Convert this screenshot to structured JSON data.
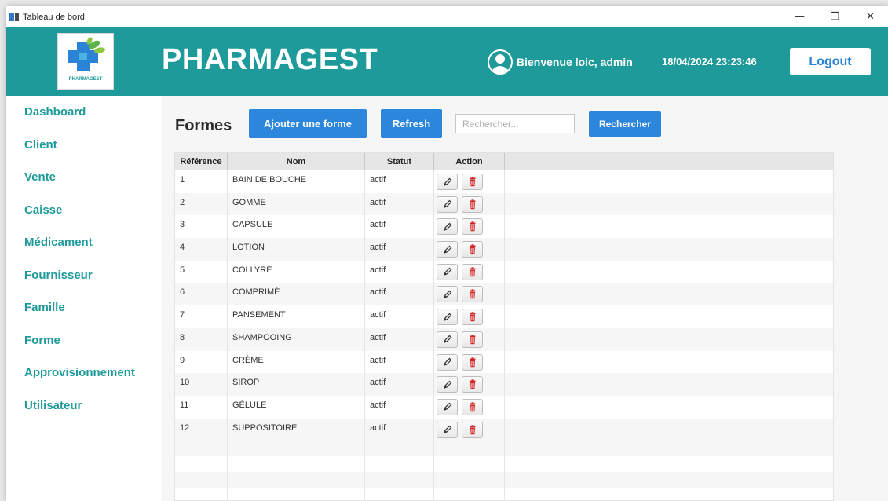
{
  "window": {
    "title": "Tableau de bord",
    "minimize": "—",
    "maximize": "❐",
    "close": "✕"
  },
  "header": {
    "logo_text": "PHARMAGEST",
    "brand": "PHARMAGEST",
    "welcome": "Bienvenue loic, admin",
    "datetime": "18/04/2024 23:23:46",
    "logout_label": "Logout",
    "color": "#1e9a9a"
  },
  "sidebar": {
    "items": [
      {
        "label": "Dashboard"
      },
      {
        "label": "Client"
      },
      {
        "label": "Vente"
      },
      {
        "label": "Caisse"
      },
      {
        "label": "Médicament"
      },
      {
        "label": "Fournisseur"
      },
      {
        "label": "Famille"
      },
      {
        "label": "Forme"
      },
      {
        "label": "Approvisionnement"
      },
      {
        "label": "Utilisateur"
      }
    ]
  },
  "main": {
    "title": "Formes",
    "add_label": "Ajouter une forme",
    "refresh_label": "Refresh",
    "search_placeholder": "Rechercher...",
    "search_label": "Rechercher",
    "table": {
      "columns": [
        "Référence",
        "Nom",
        "Statut",
        "Action"
      ],
      "rows": [
        {
          "ref": "1",
          "nom": "BAIN DE BOUCHE",
          "statut": "actif"
        },
        {
          "ref": "2",
          "nom": "GOMME",
          "statut": "actif"
        },
        {
          "ref": "3",
          "nom": "CAPSULE",
          "statut": "actif"
        },
        {
          "ref": "4",
          "nom": "LOTION",
          "statut": "actif"
        },
        {
          "ref": "5",
          "nom": "COLLYRE",
          "statut": "actif"
        },
        {
          "ref": "6",
          "nom": "COMPRIMÉ",
          "statut": "actif"
        },
        {
          "ref": "7",
          "nom": "PANSEMENT",
          "statut": "actif"
        },
        {
          "ref": "8",
          "nom": "SHAMPOOING",
          "statut": "actif"
        },
        {
          "ref": "9",
          "nom": "CRÈME",
          "statut": "actif"
        },
        {
          "ref": "10",
          "nom": "SIROP",
          "statut": "actif"
        },
        {
          "ref": "11",
          "nom": "GÉLULE",
          "statut": "actif"
        },
        {
          "ref": "12",
          "nom": "SUPPOSITOIRE",
          "statut": "actif"
        }
      ],
      "row_actions": [
        "pencil-icon",
        "trash-icon"
      ]
    }
  }
}
